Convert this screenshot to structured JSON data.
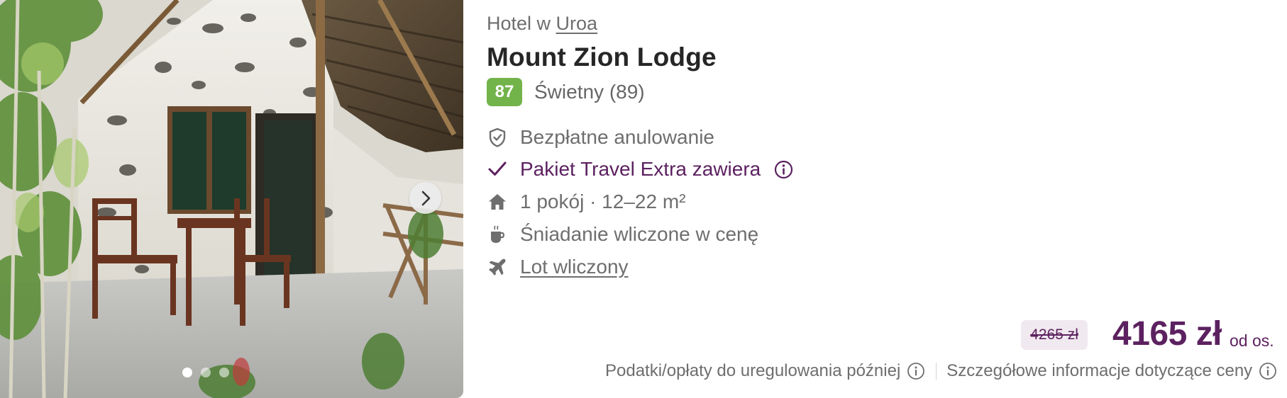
{
  "location": {
    "prefix": "Hotel w",
    "city": "Uroa"
  },
  "hotel": {
    "name": "Mount Zion Lodge"
  },
  "rating": {
    "score": "87",
    "label": "Świetny (89)"
  },
  "features": [
    {
      "icon": "shield-check-icon",
      "text": "Bezpłatne anulowanie"
    },
    {
      "icon": "checkmark-icon",
      "text": "Pakiet Travel Extra zawiera"
    },
    {
      "icon": "house-icon",
      "text": "1 pokój · 12–22 m²"
    },
    {
      "icon": "coffee-cup-icon",
      "text": "Śniadanie wliczone w cenę"
    },
    {
      "icon": "airplane-icon",
      "text": "Lot wliczony"
    }
  ],
  "price": {
    "old": "4265 zł",
    "current": "4165 zł",
    "per": "od os."
  },
  "fees": {
    "taxes": "Podatki/opłaty do uregulowania później",
    "details": "Szczegółowe informacje dotyczące ceny"
  },
  "gallery": {
    "photo_count": 3,
    "active_index": 0
  },
  "colors": {
    "brand": "#5c2160",
    "rating": "#72b34a",
    "muted": "#6e6e6e"
  }
}
